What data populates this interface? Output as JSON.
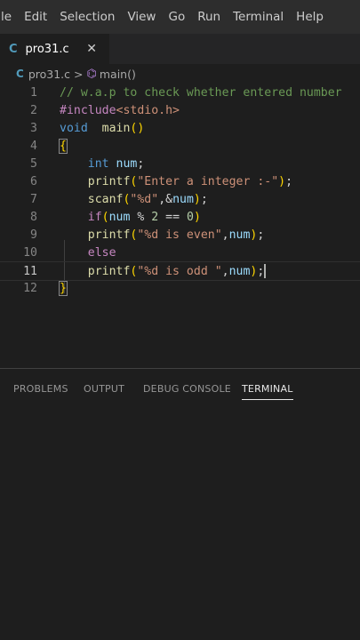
{
  "menu": [
    "le",
    "Edit",
    "Selection",
    "View",
    "Go",
    "Run",
    "Terminal",
    "Help"
  ],
  "tab": {
    "icon": "C",
    "name": "pro31.c",
    "close": "✕"
  },
  "breadcrumb": {
    "icon": "C",
    "file": "pro31.c",
    "separator": ">",
    "symbol": "main()"
  },
  "editor": {
    "current_line": 11,
    "lines": [
      {
        "n": "1"
      },
      {
        "n": "2"
      },
      {
        "n": "3"
      },
      {
        "n": "4"
      },
      {
        "n": "5"
      },
      {
        "n": "6"
      },
      {
        "n": "7"
      },
      {
        "n": "8"
      },
      {
        "n": "9"
      },
      {
        "n": "10"
      },
      {
        "n": "11"
      },
      {
        "n": "12"
      }
    ],
    "tokens": {
      "l1": "// w.a.p to check whether entered number",
      "l2_dir": "#include",
      "l2_hdr": "<stdio.h>",
      "l3_type": "void",
      "l3_fn": "main",
      "l3_parens": "()",
      "l4_brace": "{",
      "l5_type": "int",
      "l5_var": "num",
      "l5_semi": ";",
      "l6_fn": "printf",
      "l6_str": "\"Enter a integer :-\"",
      "l7_fn": "scanf",
      "l7_str": "\"%d\"",
      "l7_rest": ",&",
      "l7_var": "num",
      "l8_kw": "if",
      "l8_var": "num",
      "l8_op": " % ",
      "l8_n1": "2",
      "l8_eq": " == ",
      "l8_n2": "0",
      "l9_fn": "printf",
      "l9_str": "\"%d is even\"",
      "l9_var": "num",
      "l10_kw": "else",
      "l11_fn": "printf",
      "l11_str": "\"%d is odd \"",
      "l11_var": "num",
      "l12_brace": "}"
    }
  },
  "panel": {
    "tabs": [
      "PROBLEMS",
      "OUTPUT",
      "DEBUG CONSOLE",
      "TERMINAL"
    ],
    "active": "TERMINAL"
  }
}
